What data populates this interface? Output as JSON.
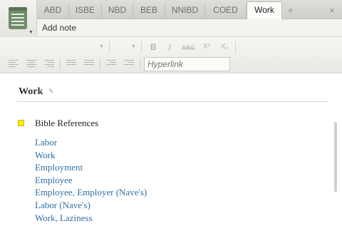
{
  "tabs": [
    {
      "label": "ABD"
    },
    {
      "label": "ISBE"
    },
    {
      "label": "NBD"
    },
    {
      "label": "BEB"
    },
    {
      "label": "NNIBD"
    },
    {
      "label": "COED"
    },
    {
      "label": "Work",
      "active": true
    }
  ],
  "tab_add_glyph": "+",
  "tab_close_glyph": "×",
  "toolbar": {
    "add_note_label": "Add note",
    "bold_label": "B",
    "italic_label": "I",
    "strike_label": "ABC",
    "superscript_label": "X²",
    "subscript_label": "X₂",
    "hyperlink_placeholder": "Hyperlink"
  },
  "note": {
    "title": "Work",
    "section_label": "Bible References",
    "references": [
      "Labor",
      "Work",
      "Employment",
      "Employee",
      "Employee, Employer (Nave's)",
      "Labor (Nave's)",
      "Work, Laziness"
    ]
  },
  "colors": {
    "link": "#2f6ea3",
    "bullet": "#f3f000",
    "app_icon": "#6e8c69"
  },
  "icons": {
    "app": "notes-app-icon",
    "edit": "pencil-icon"
  }
}
